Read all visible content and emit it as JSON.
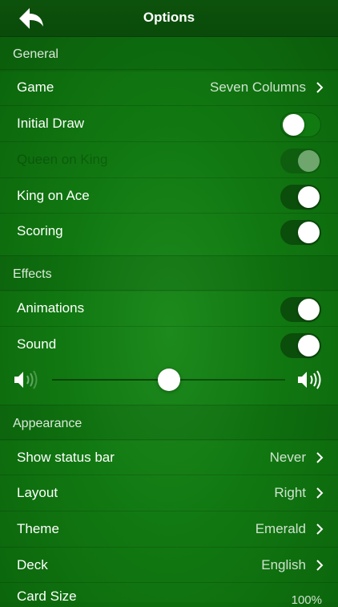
{
  "navbar": {
    "title": "Options",
    "back_icon": "back-arrow-icon"
  },
  "general": {
    "header": "General",
    "game": {
      "label": "Game",
      "value": "Seven Columns"
    },
    "initial_draw": {
      "label": "Initial Draw",
      "state": "off"
    },
    "queen_on_king": {
      "label": "Queen on King",
      "state": "on",
      "disabled": true
    },
    "king_on_ace": {
      "label": "King on Ace",
      "state": "on"
    },
    "scoring": {
      "label": "Scoring",
      "state": "on"
    }
  },
  "effects": {
    "header": "Effects",
    "animations": {
      "label": "Animations",
      "state": "on"
    },
    "sound": {
      "label": "Sound",
      "state": "on"
    },
    "volume": {
      "level": 0.5,
      "min_icon": "speaker-low-icon",
      "max_icon": "speaker-high-icon"
    }
  },
  "appearance": {
    "header": "Appearance",
    "status_bar": {
      "label": "Show status bar",
      "value": "Never"
    },
    "layout": {
      "label": "Layout",
      "value": "Right"
    },
    "theme": {
      "label": "Theme",
      "value": "Emerald"
    },
    "deck": {
      "label": "Deck",
      "value": "English"
    },
    "card_size": {
      "label": "Card Size",
      "value": "100%"
    }
  }
}
